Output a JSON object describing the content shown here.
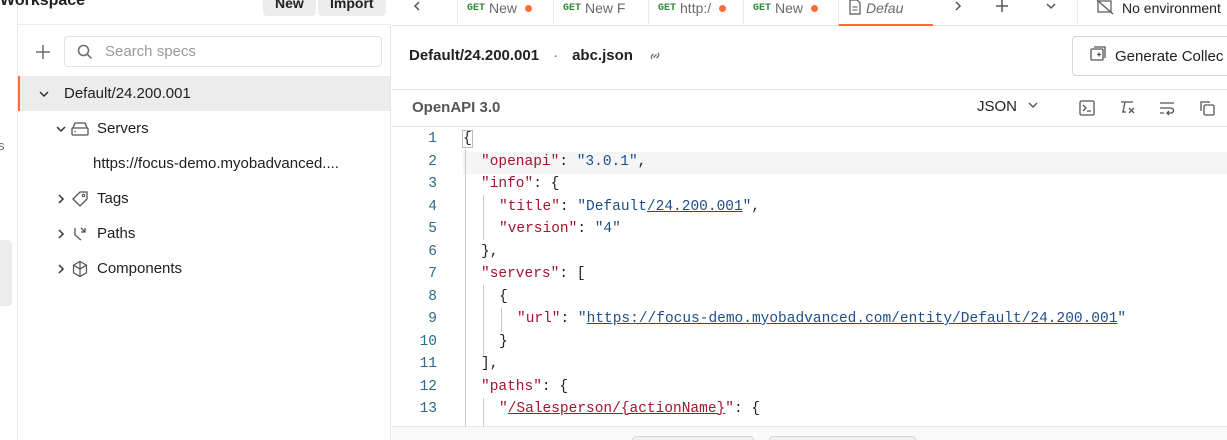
{
  "workspace": {
    "title": "Workspace",
    "new_label": "New",
    "import_label": "Import"
  },
  "rail": {
    "cropped_text": "s"
  },
  "sidebar": {
    "search_placeholder": "Search specs",
    "tree": [
      {
        "label": "Default/24.200.001",
        "expanded": true,
        "selected": true
      },
      {
        "label": "Servers",
        "icon": "server-icon",
        "expanded": true
      },
      {
        "label": "https://focus-demo.myobadvanced...."
      },
      {
        "label": "Tags",
        "icon": "tag-icon",
        "expanded": false
      },
      {
        "label": "Paths",
        "icon": "paths-icon",
        "expanded": false
      },
      {
        "label": "Components",
        "icon": "components-icon",
        "expanded": false
      }
    ]
  },
  "tabs": [
    {
      "method": "GET",
      "label": "New",
      "unsaved": true
    },
    {
      "method": "GET",
      "label": "New F",
      "unsaved": false
    },
    {
      "method": "GET",
      "label": "http:/",
      "unsaved": true
    },
    {
      "method": "GET",
      "label": "New",
      "unsaved": true
    },
    {
      "label": "Defau",
      "icon": "document-icon",
      "active": true
    }
  ],
  "environment": {
    "label": "No environment"
  },
  "header": {
    "spec_name": "Default/24.200.001",
    "separator": "·",
    "file_name": "abc.json",
    "generate_label": "Generate Collec"
  },
  "subbar": {
    "spec_type": "OpenAPI 3.0",
    "format": "JSON"
  },
  "code": {
    "line_numbers": [
      "1",
      "2",
      "3",
      "4",
      "5",
      "6",
      "7",
      "8",
      "9",
      "10",
      "11",
      "12",
      "13"
    ],
    "l1": "{",
    "l2_key": "\"openapi\"",
    "l2_val": "\"3.0.1\"",
    "l3_key": "\"info\"",
    "l4_key": "\"title\"",
    "l4_val_a": "\"Default",
    "l4_val_b": "/24.200.001",
    "l4_val_c": "\"",
    "l5_key": "\"version\"",
    "l5_val": "\"4\"",
    "l6": "},",
    "l7_key": "\"servers\"",
    "l8": "{",
    "l9_key": "\"url\"",
    "l9_val": "https://focus-demo.myobadvanced.com/entity/Default/24.200.001",
    "l10": "}",
    "l11": "],",
    "l12_key": "\"paths\"",
    "l13_key_path": "/Salesperson/{actionName}"
  },
  "colors": {
    "accent": "#ff6c37",
    "key": "#a3162c",
    "string": "#1c4f8a",
    "line_number": "#2a6b8a"
  }
}
